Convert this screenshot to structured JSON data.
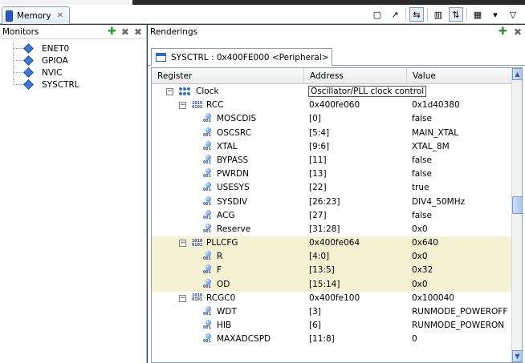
{
  "view_tab": {
    "label": "Memory",
    "close": "✕"
  },
  "monitors": {
    "title": "Monitors",
    "add_icon": "plus-icon",
    "remove_icon": "remove-icon",
    "items": [
      {
        "label": "ENET0"
      },
      {
        "label": "GPIOA"
      },
      {
        "label": "NVIC"
      },
      {
        "label": "SYSCTRL"
      }
    ]
  },
  "renderings": {
    "title": "Renderings",
    "tab_label": "SYSCTRL : 0x400FE000 <Peripheral>"
  },
  "table": {
    "headers": [
      "Register",
      "Address",
      "Value"
    ],
    "rows": [
      {
        "kind": "cluster",
        "name": "Clock",
        "address": "Oscillator/PLL clock control",
        "value": "",
        "depth": 0,
        "editing": true
      },
      {
        "kind": "register",
        "name": "RCC",
        "address": "0x400fe060",
        "value": "0x1d40380",
        "depth": 1
      },
      {
        "kind": "field",
        "name": "MOSCDIS",
        "address": "[0]",
        "value": "false",
        "depth": 2
      },
      {
        "kind": "field",
        "name": "OSCSRC",
        "address": "[5:4]",
        "value": "MAIN_XTAL",
        "depth": 2
      },
      {
        "kind": "field",
        "name": "XTAL",
        "address": "[9:6]",
        "value": "XTAL_8M",
        "depth": 2
      },
      {
        "kind": "field",
        "name": "BYPASS",
        "address": "[11]",
        "value": "false",
        "depth": 2
      },
      {
        "kind": "field",
        "name": "PWRDN",
        "address": "[13]",
        "value": "false",
        "depth": 2
      },
      {
        "kind": "field",
        "name": "USESYS",
        "address": "[22]",
        "value": "true",
        "depth": 2
      },
      {
        "kind": "field",
        "name": "SYSDIV",
        "address": "[26:23]",
        "value": "DIV4_50MHz",
        "depth": 2
      },
      {
        "kind": "field",
        "name": "ACG",
        "address": "[27]",
        "value": "false",
        "depth": 2
      },
      {
        "kind": "field",
        "name": "Reserve",
        "address": "[31:28]",
        "value": "0x0",
        "depth": 2
      },
      {
        "kind": "register",
        "name": "PLLCFG",
        "address": "0x400fe064",
        "value": "0x640",
        "depth": 1,
        "highlight": true
      },
      {
        "kind": "field",
        "name": "R",
        "address": "[4:0]",
        "value": "0x0",
        "depth": 2,
        "highlight": true
      },
      {
        "kind": "field",
        "name": "F",
        "address": "[13:5]",
        "value": "0x32",
        "depth": 2,
        "highlight": true
      },
      {
        "kind": "field",
        "name": "OD",
        "address": "[15:14]",
        "value": "0x0",
        "depth": 2,
        "highlight": true
      },
      {
        "kind": "register",
        "name": "RCGC0",
        "address": "0x400fe100",
        "value": "0x100040",
        "depth": 1
      },
      {
        "kind": "field",
        "name": "WDT",
        "address": "[3]",
        "value": "RUNMODE_POWEROFF",
        "depth": 2
      },
      {
        "kind": "field",
        "name": "HIB",
        "address": "[6]",
        "value": "RUNMODE_POWERON",
        "depth": 2
      },
      {
        "kind": "field",
        "name": "MAXADCSPD",
        "address": "[11:8]",
        "value": "0",
        "depth": 2
      }
    ]
  },
  "colors": {
    "highlight_row": "#f5f2d3",
    "accent": "#2f6fd6"
  }
}
